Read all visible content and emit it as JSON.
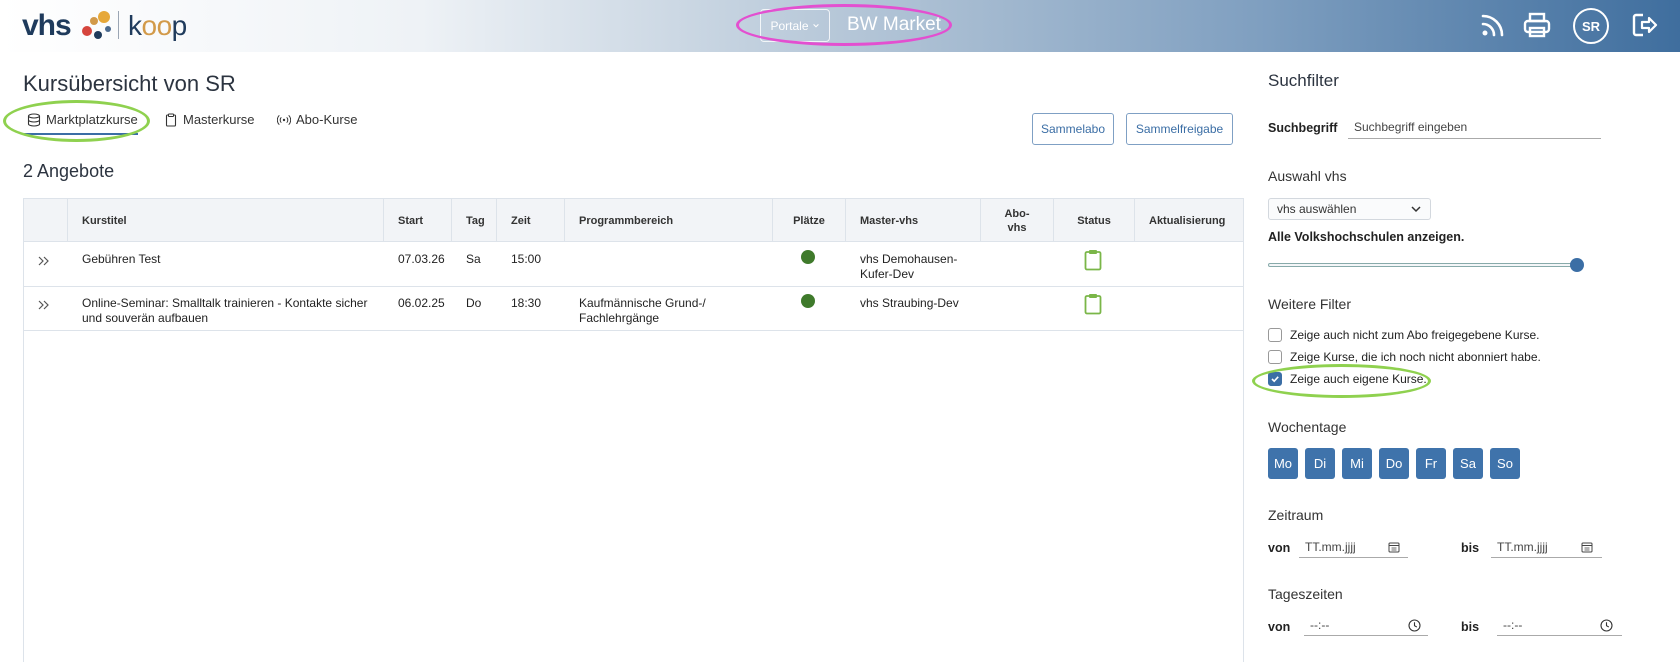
{
  "header": {
    "logo_vhs": "vhs",
    "logo_koop_k": "k",
    "logo_koop_oo": "oo",
    "logo_koop_p": "p",
    "portale_label": "Portale",
    "market_title": "BW Market",
    "avatar_initials": "SR",
    "icons": [
      "rss-icon",
      "printer-icon",
      "logout-icon"
    ]
  },
  "main": {
    "page_title": "Kursübersicht von SR",
    "tabs": [
      {
        "label": "Marktplatzkurse",
        "icon": "database-icon",
        "active": true
      },
      {
        "label": "Masterkurse",
        "icon": "clipboard-icon",
        "active": false
      },
      {
        "label": "Abo-Kurse",
        "icon": "broadcast-icon",
        "active": false
      }
    ],
    "buttons": {
      "sammelabo": "Sammelabo",
      "sammelfreigabe": "Sammelfreigabe"
    },
    "count": "2 Angebote",
    "table": {
      "headers": [
        "Kurstitel",
        "Start",
        "Tag",
        "Zeit",
        "Programmbereich",
        "Plätze",
        "Master-vhs",
        "Abo-",
        "vhs",
        "Status",
        "Aktualisierung"
      ],
      "rows": [
        {
          "title_line1": "Gebühren Test",
          "title_line2": "",
          "start": "07.03.26",
          "tag": "Sa",
          "zeit": "15:00",
          "programm_line1": "",
          "programm_line2": "",
          "master_line1": "vhs Demohausen-",
          "master_line2": "Kufer-Dev",
          "abo": "",
          "aktualisierung": ""
        },
        {
          "title_line1": "Online-Seminar: Smalltalk trainieren - Kontakte sicher",
          "title_line2": "und souverän aufbauen",
          "start": "06.02.25",
          "tag": "Do",
          "zeit": "18:30",
          "programm_line1": "Kaufmännische Grund-/",
          "programm_line2": "Fachlehrgänge",
          "master_line1": "vhs Straubing-Dev",
          "master_line2": "",
          "abo": "",
          "aktualisierung": ""
        }
      ]
    }
  },
  "sidebar": {
    "title": "Suchfilter",
    "suchbegriff_label": "Suchbegriff",
    "suchbegriff_placeholder": "Suchbegriff eingeben",
    "auswahl_label": "Auswahl vhs",
    "auswahl_value": "vhs auswählen",
    "alle_label": "Alle Volkshochschulen anzeigen.",
    "alle_slider_value": 1.0,
    "weitere_label": "Weitere Filter",
    "filters": [
      {
        "label": "Zeige auch nicht zum Abo freigegebene Kurse.",
        "checked": false
      },
      {
        "label": "Zeige Kurse, die ich noch nicht abonniert habe.",
        "checked": false
      },
      {
        "label": "Zeige auch eigene Kurse.",
        "checked": true
      }
    ],
    "wochentage_label": "Wochentage",
    "days": [
      "Mo",
      "Di",
      "Mi",
      "Do",
      "Fr",
      "Sa",
      "So"
    ],
    "zeitraum_label": "Zeitraum",
    "von": "von",
    "bis": "bis",
    "date_placeholder": "TT.mm.jjjj",
    "tageszeiten_label": "Tageszeiten",
    "time_placeholder": "--:--"
  },
  "colors": {
    "accent": "#3b6ea5",
    "green_dot": "#3f7a2b",
    "clipboard": "#7ab648",
    "highlight_green": "#8fd14f",
    "highlight_pink": "#e34fd0"
  }
}
